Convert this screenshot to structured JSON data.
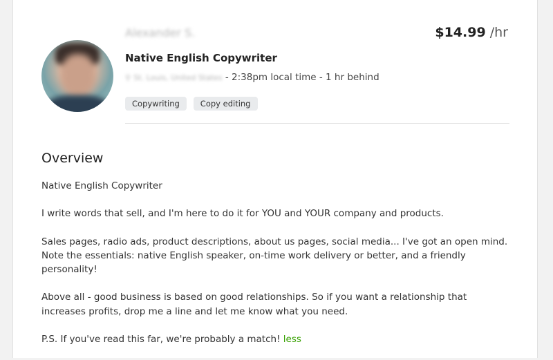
{
  "profile": {
    "name": "Alexander S.",
    "rate_amount": "$14.99",
    "rate_unit": "/hr",
    "title": "Native English Copywriter",
    "location": "St. Louis, United States",
    "local_time": " - 2:38pm local time - 1 hr behind",
    "skills": [
      "Copywriting",
      "Copy editing"
    ]
  },
  "overview": {
    "heading": "Overview",
    "paragraphs": [
      "Native English Copywriter",
      "I write words that sell, and I'm here to do it for YOU and YOUR company and products.",
      "Sales pages, radio ads, product descriptions, about us pages, social media... I've got an open mind. Note the essentials: native English speaker, on-time work delivery or better, and a friendly personality!",
      "Above all - good business is based on good relationships. So if you want a relationship that increases profits, drop me a line and let me know what you need.",
      "P.S. If you've read this far, we're probably a match! "
    ],
    "less_link": "less"
  }
}
